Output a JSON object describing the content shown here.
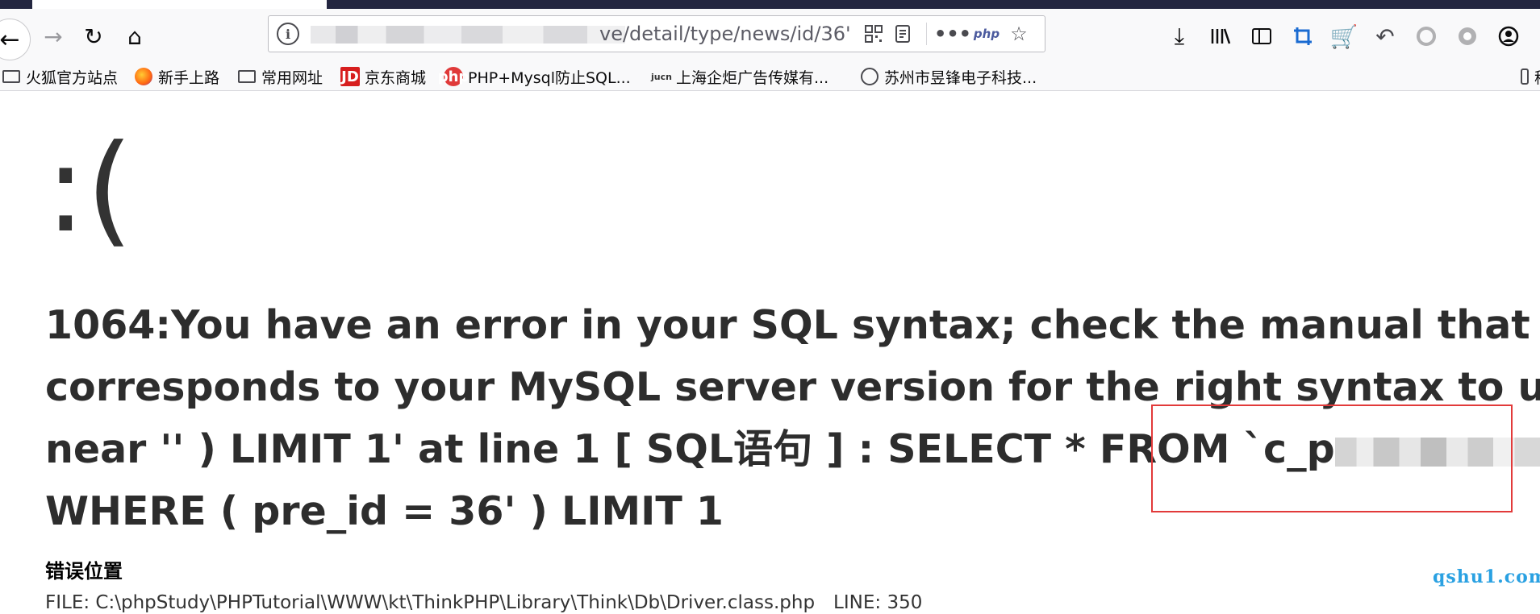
{
  "browser": {
    "url_visible": "ve/detail/type/news/id/36'",
    "info_glyph": "i",
    "nav_icons": [
      "back-arrow-icon",
      "forward-arrow-icon",
      "reload-icon",
      "home-icon"
    ],
    "url_icons": [
      "qr-code-icon",
      "reader-view-icon",
      "more-icon",
      "php-icon",
      "star-icon"
    ],
    "php_label": "php",
    "right_icons": [
      "download-icon",
      "library-icon",
      "sidebar-icon",
      "crop-icon",
      "cart-icon",
      "undo-icon",
      "circle-icon",
      "extension-icon",
      "account-icon"
    ],
    "bookmarks": [
      {
        "label": "火狐官方站点",
        "icon": "folder-icon"
      },
      {
        "label": "新手上路",
        "icon": "firefox-icon"
      },
      {
        "label": "常用网址",
        "icon": "folder-icon"
      },
      {
        "label": "京东商城",
        "icon": "jd-icon"
      },
      {
        "label": "PHP+Mysql防止SQL...",
        "icon": "php-site-icon"
      },
      {
        "label": "上海企炬广告传媒有...",
        "icon": "jucn-icon"
      },
      {
        "label": "苏州市昱锋电子科技...",
        "icon": "globe-icon"
      }
    ],
    "jd_text": "JD",
    "php_site_text": "php",
    "jucn_text": "jucn",
    "bookmark_edge_char": "移"
  },
  "page": {
    "frown": ":(",
    "error_lines": [
      "1064:You have an error in your SQL syntax; check the manual that",
      "corresponds to your MySQL server version for the right syntax to use",
      "near '' ) LIMIT 1' at line 1 [ SQL语句 ] : SELECT * FROM `c_p",
      "`",
      "WHERE ( pre_id = 36' ) LIMIT 1"
    ],
    "position_title": "错误位置",
    "file_line": "FILE: C:\\phpStudy\\PHPTutorial\\WWW\\kt\\ThinkPHP\\Library\\Think\\Db\\Driver.class.php　LINE: 350",
    "watermark": "qshu1.com"
  },
  "colors": {
    "highlight_box": "#e23a3a",
    "watermark": "#2aa1e2",
    "error_text": "#2d2d2d"
  }
}
